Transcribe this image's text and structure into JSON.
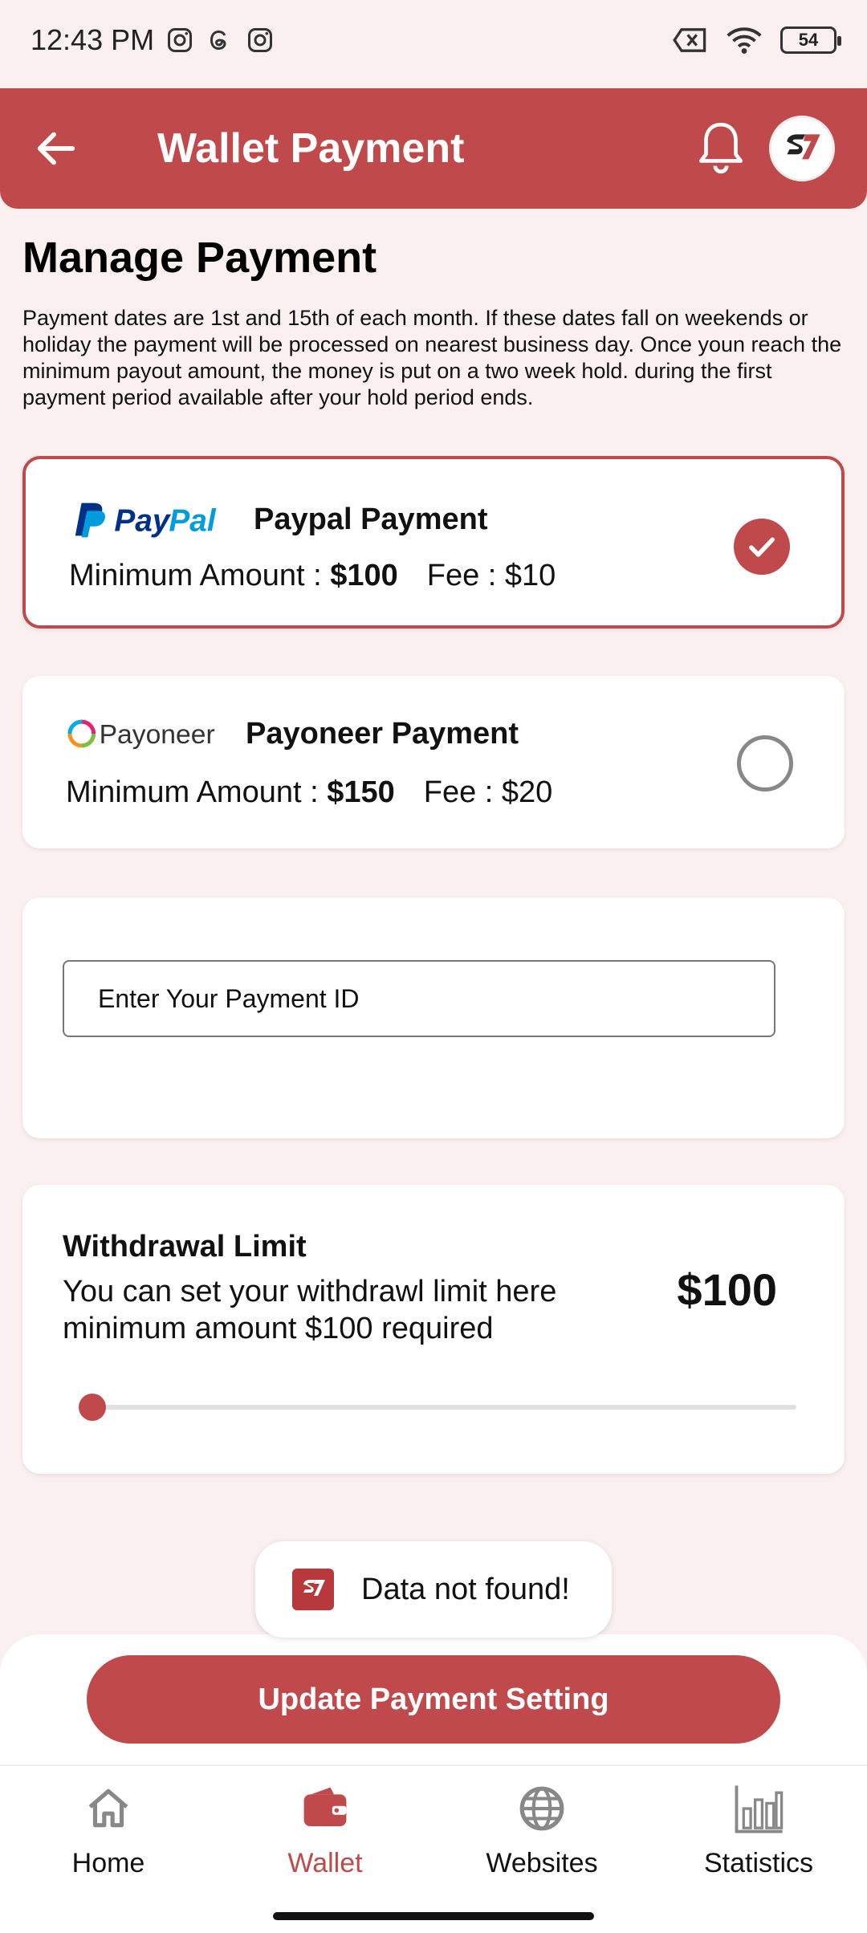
{
  "status_bar": {
    "time": "12:43 PM",
    "battery": "54"
  },
  "header": {
    "title": "Wallet Payment"
  },
  "main": {
    "title": "Manage Payment",
    "description": "Payment dates are 1st and 15th of each month. If these dates fall on weekends or holiday the payment will be processed on nearest business day. Once youn reach the minimum payout amount, the money is put on a two week hold. during the first payment period available after your hold period ends."
  },
  "payment_methods": [
    {
      "brand": "PayPal",
      "name": "Paypal Payment",
      "min_label": "Minimum Amount : ",
      "min_amount": "$100",
      "fee": "Fee : $10",
      "selected": true
    },
    {
      "brand": "Payoneer",
      "name": "Payoneer Payment",
      "min_label": "Minimum Amount : ",
      "min_amount": "$150",
      "fee": "Fee : $20",
      "selected": false
    }
  ],
  "payment_id": {
    "placeholder": "Enter Your Payment ID",
    "value": ""
  },
  "withdrawal": {
    "title": "Withdrawal Limit",
    "description": "You can set your withdrawl limit here minimum amount $100 required",
    "value": "$100",
    "slider_fraction": 0
  },
  "toast": {
    "text": "Data not found!"
  },
  "update_button": {
    "label": "Update Payment Setting"
  },
  "nav": [
    {
      "label": "Home",
      "icon": "home-icon",
      "active": false
    },
    {
      "label": "Wallet",
      "icon": "wallet-icon",
      "active": true
    },
    {
      "label": "Websites",
      "icon": "globe-icon",
      "active": false
    },
    {
      "label": "Statistics",
      "icon": "bar-chart-icon",
      "active": false
    }
  ],
  "colors": {
    "accent": "#c0494b",
    "background": "#fbf0f0"
  }
}
